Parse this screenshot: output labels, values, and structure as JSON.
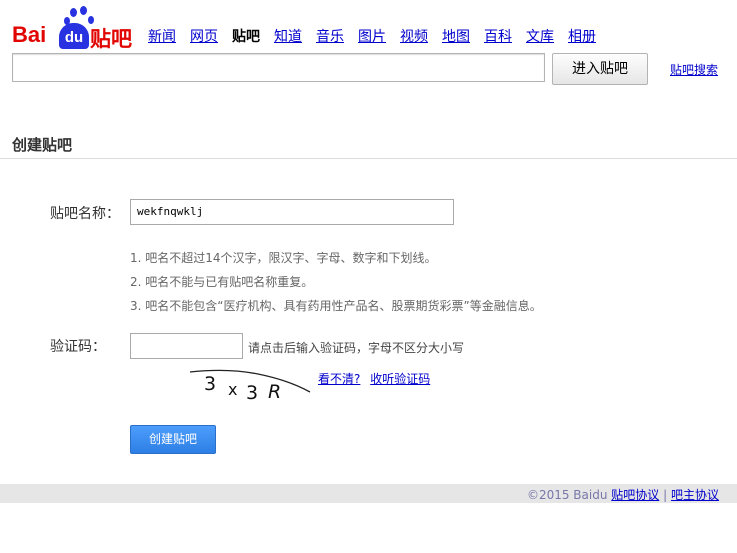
{
  "logo": {
    "bai": "Bai",
    "du": "du",
    "tieba": "贴吧"
  },
  "nav": [
    "新闻",
    "网页",
    "贴吧",
    "知道",
    "音乐",
    "图片",
    "视频",
    "地图",
    "百科",
    "文库",
    "相册"
  ],
  "search": {
    "enter_button": "进入贴吧",
    "tieba_search_link": "贴吧搜索"
  },
  "page": {
    "title": "创建贴吧"
  },
  "form": {
    "name_label": "贴吧名称：",
    "name_value": "wekfnqwklj",
    "rules": [
      "1. 吧名不超过14个汉字，限汉字、字母、数字和下划线。",
      "2. 吧名不能与已有贴吧名称重复。",
      "3. 吧名不能包含“医疗机构、具有药用性产品名、股票期货彩票”等金融信息。"
    ],
    "captcha_label": "验证码：",
    "captcha_hint": "请点击后输入验证码，字母不区分大小写",
    "captcha_text": "3 x 3 R",
    "captcha_unclear": "看不清?",
    "captcha_listen": "收听验证码",
    "create_button": "创建贴吧"
  },
  "footer": {
    "copyright": "©2015 Baidu",
    "agreement": "贴吧协议",
    "separator": "|",
    "moderator": "吧主协议"
  }
}
